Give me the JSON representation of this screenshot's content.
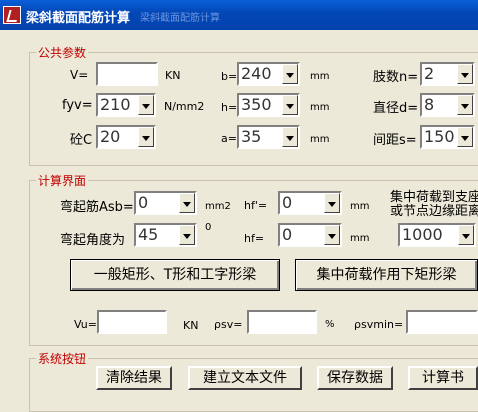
{
  "title_bar": {
    "title": "梁斜截面配筋计算",
    "subtitle": "梁斜截面配筋计算"
  },
  "public_params": {
    "legend": "公共参数",
    "V_label": "V=",
    "V_value": "",
    "V_unit": "KN",
    "b_label": "b=",
    "b_value": "240",
    "b_unit": "mm",
    "legs_label": "肢数n=",
    "legs_value": "2",
    "fyv_label": "fyv=",
    "fyv_value": "210",
    "fyv_unit": "N/mm2",
    "h_label": "h=",
    "h_value": "350",
    "h_unit": "mm",
    "dia_label": "直径d=",
    "dia_value": "8",
    "concrete_label": "砼C",
    "concrete_value": "20",
    "a_label": "a=",
    "a_value": "35",
    "a_unit": "mm",
    "spacing_label": "间距s=",
    "spacing_value": "150"
  },
  "calc": {
    "legend": "计算界面",
    "asb_label": "弯起筋Asb=",
    "asb_value": "0",
    "asb_unit": "mm2",
    "hf1_label": "hf'=",
    "hf1_value": "0",
    "hf1_unit": "mm",
    "dist_label_1": "集中荷载到支座",
    "dist_label_2": "或节点边缘距离",
    "angle_label": "弯起角度为",
    "angle_value": "45",
    "angle_unit": "0",
    "hf2_label": "hf=",
    "hf2_value": "0",
    "hf2_unit": "mm",
    "dist_value": "1000",
    "btn_general": "一般矩形、T形和工字形梁",
    "btn_concentrated": "集中荷载作用下矩形梁",
    "vu_label": "Vu=",
    "vu_value": "",
    "vu_unit": "KN",
    "psv_label": "ρsv=",
    "psv_value": "",
    "psv_unit": "%",
    "psvmin_label": "ρsvmin=",
    "psvmin_value": ""
  },
  "system": {
    "legend": "系统按钮",
    "btn_clear": "清除结果",
    "btn_textfile": "建立文本文件",
    "btn_save": "保存数据",
    "btn_calc": "计算书"
  }
}
